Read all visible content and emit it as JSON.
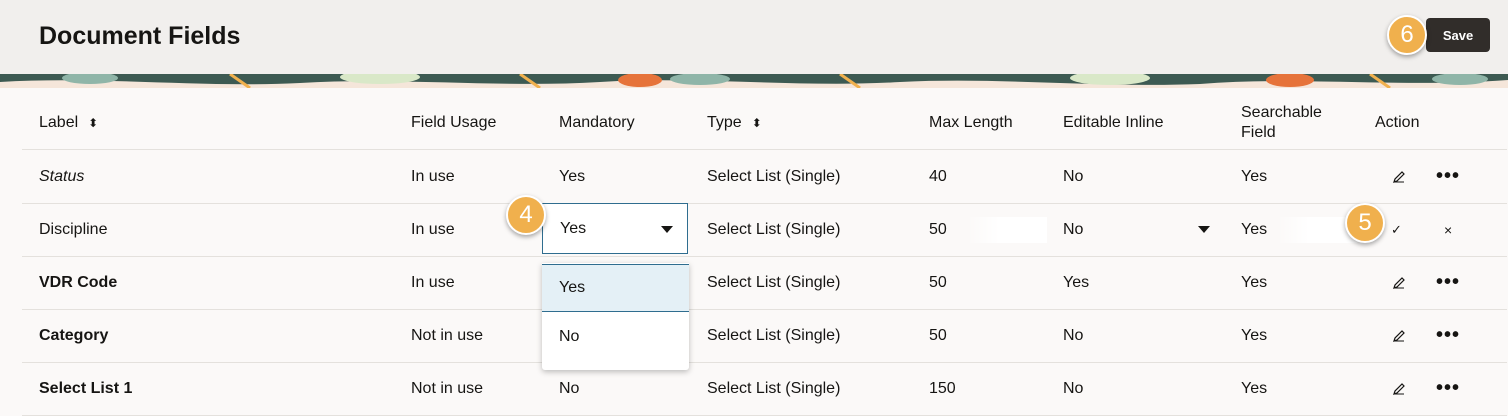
{
  "page": {
    "title": "Document Fields",
    "save_label": "Save"
  },
  "columns": {
    "label": "Label",
    "field_usage": "Field Usage",
    "mandatory": "Mandatory",
    "type": "Type",
    "max_length": "Max Length",
    "editable_inline": "Editable Inline",
    "searchable_line1": "Searchable",
    "searchable_line2": "Field",
    "action": "Action"
  },
  "rows": [
    {
      "label": "Status",
      "field_usage": "In use",
      "mandatory": "Yes",
      "type": "Select List (Single)",
      "max_length": "40",
      "editable_inline": "No",
      "searchable": "Yes"
    },
    {
      "label": "Discipline",
      "field_usage": "In use",
      "mandatory": "Yes",
      "type": "Select List (Single)",
      "max_length": "50",
      "editable_inline": "No",
      "searchable": "Yes"
    },
    {
      "label": "VDR Code",
      "field_usage": "In use",
      "mandatory": "",
      "type": "Select List (Single)",
      "max_length": "50",
      "editable_inline": "Yes",
      "searchable": "Yes"
    },
    {
      "label": "Category",
      "field_usage": "Not in use",
      "mandatory": "",
      "type": "Select List (Single)",
      "max_length": "50",
      "editable_inline": "No",
      "searchable": "Yes"
    },
    {
      "label": "Select List 1",
      "field_usage": "Not in use",
      "mandatory": "No",
      "type": "Select List (Single)",
      "max_length": "150",
      "editable_inline": "No",
      "searchable": "Yes"
    }
  ],
  "dropdown": {
    "options": [
      "Yes",
      "No"
    ],
    "selected": "Yes"
  },
  "callouts": {
    "four": "4",
    "five": "5",
    "six": "6"
  },
  "icons": {
    "edit": "pencil-icon",
    "more": "more-actions-icon",
    "confirm": "check-icon",
    "cancel": "close-icon",
    "sort": "sort-icon",
    "caret": "chevron-down-icon"
  },
  "colors": {
    "save_bg": "#312d2a",
    "badge": "#f0b04d",
    "focus_border": "#2f6d8f",
    "selected_option": "#e4f0f6"
  }
}
